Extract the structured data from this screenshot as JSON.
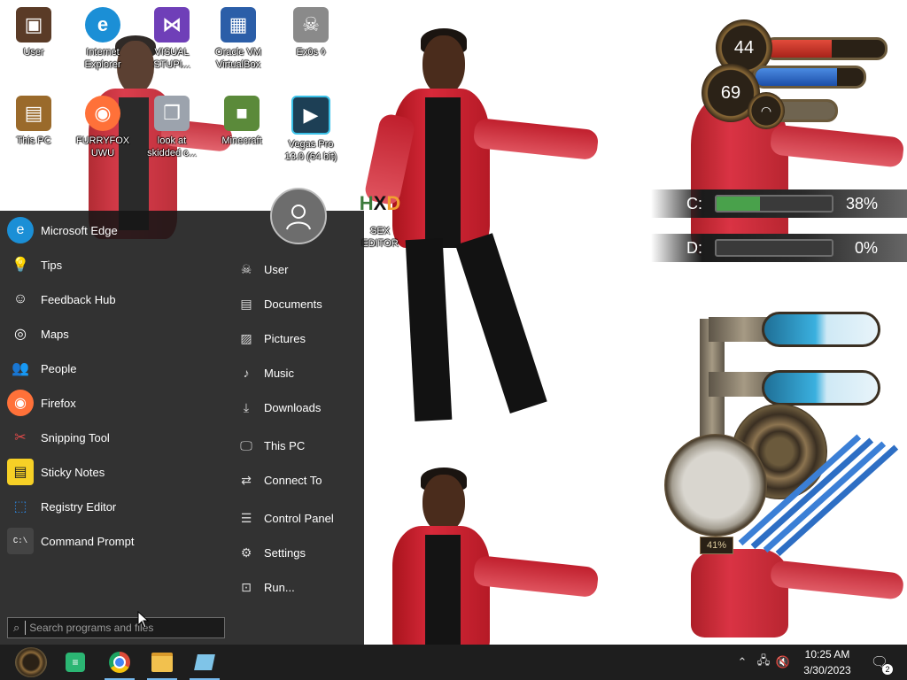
{
  "desktop": {
    "icons": [
      {
        "label": "User",
        "icon": "user-folder-icon",
        "color": "#5a3b27"
      },
      {
        "label": "Internet Explorer",
        "icon": "edge-icon",
        "color": "#1b8fd6"
      },
      {
        "label": "VISUAL STUPI...",
        "icon": "visual-studio-icon",
        "color": "#6f3fb8"
      },
      {
        "label": "Oracle VM VirtualBox",
        "icon": "virtualbox-icon",
        "color": "#2b5ea8"
      },
      {
        "label": "Ex0s ◊",
        "icon": "cat-icon",
        "color": "#8a8a8a"
      },
      {
        "label": "This PC",
        "icon": "this-pc-icon",
        "color": "#9a6a2b"
      },
      {
        "label": "FURRYFOX UWU",
        "icon": "firefox-icon",
        "color": "#ff7139"
      },
      {
        "label": "look at skidded c...",
        "icon": "copy-icon",
        "color": "#9ca3ad"
      },
      {
        "label": "Minecraft",
        "icon": "minecraft-icon",
        "color": "#5b8a3a"
      },
      {
        "label": "Vegas Pro 13.0 (64 bit)",
        "icon": "vegas-icon",
        "color": "#1d3f55"
      },
      {
        "label": "SEX EDITOR",
        "icon": "hex-editor-icon",
        "color": "#f0a030"
      }
    ]
  },
  "start_menu": {
    "apps": [
      {
        "label": "Microsoft Edge",
        "icon": "edge-icon",
        "color": "#1b8fd6"
      },
      {
        "label": "Tips",
        "icon": "lightbulb-icon",
        "color": "#ffffff"
      },
      {
        "label": "Feedback Hub",
        "icon": "feedback-icon",
        "color": "#ffffff"
      },
      {
        "label": "Maps",
        "icon": "maps-icon",
        "color": "#ffffff"
      },
      {
        "label": "People",
        "icon": "people-icon",
        "color": "#ffffff"
      },
      {
        "label": "Firefox",
        "icon": "firefox-icon",
        "color": "#ff7139"
      },
      {
        "label": "Snipping Tool",
        "icon": "scissors-icon",
        "color": "#e04a4a"
      },
      {
        "label": "Sticky Notes",
        "icon": "sticky-notes-icon",
        "color": "#f6d026"
      },
      {
        "label": "Registry Editor",
        "icon": "registry-icon",
        "color": "#2d7fd1"
      },
      {
        "label": "Command Prompt",
        "icon": "command-prompt-icon",
        "color": "#444444"
      }
    ],
    "places": [
      {
        "label": "User",
        "icon": "skull-icon"
      },
      {
        "label": "Documents",
        "icon": "document-icon"
      },
      {
        "label": "Pictures",
        "icon": "pictures-icon"
      },
      {
        "label": "Music",
        "icon": "music-icon"
      },
      {
        "label": "Downloads",
        "icon": "download-icon"
      },
      {
        "label": "This PC",
        "icon": "monitor-icon"
      },
      {
        "label": "Connect To",
        "icon": "connect-icon"
      },
      {
        "label": "Control Panel",
        "icon": "control-panel-icon"
      },
      {
        "label": "Settings",
        "icon": "gear-icon"
      },
      {
        "label": "Run...",
        "icon": "run-icon"
      }
    ],
    "search_placeholder": "Search programs and files"
  },
  "widgets": {
    "cpu_value": "44",
    "cpu_fill": 0.55,
    "cpu_color": "#d9352b",
    "ram_value": "69",
    "ram_fill": 0.75,
    "ram_color": "#2b6fd9",
    "drives": [
      {
        "label": "C:",
        "percent": "38%",
        "fill": 0.38
      },
      {
        "label": "D:",
        "percent": "0%",
        "fill": 0.0
      }
    ],
    "dial_value": "41%"
  },
  "taskbar": {
    "apps": [
      {
        "name": "steampunk-start-icon",
        "color": "#8c6a3a"
      },
      {
        "name": "chat-app-icon",
        "color": "#2bb673"
      },
      {
        "name": "chrome-icon",
        "color": "#dd4b39"
      },
      {
        "name": "file-explorer-icon",
        "color": "#f2c14e"
      },
      {
        "name": "notepad-icon",
        "color": "#7fc4e8"
      }
    ],
    "time": "10:25 AM",
    "date": "3/30/2023",
    "notifications_count": "2"
  }
}
